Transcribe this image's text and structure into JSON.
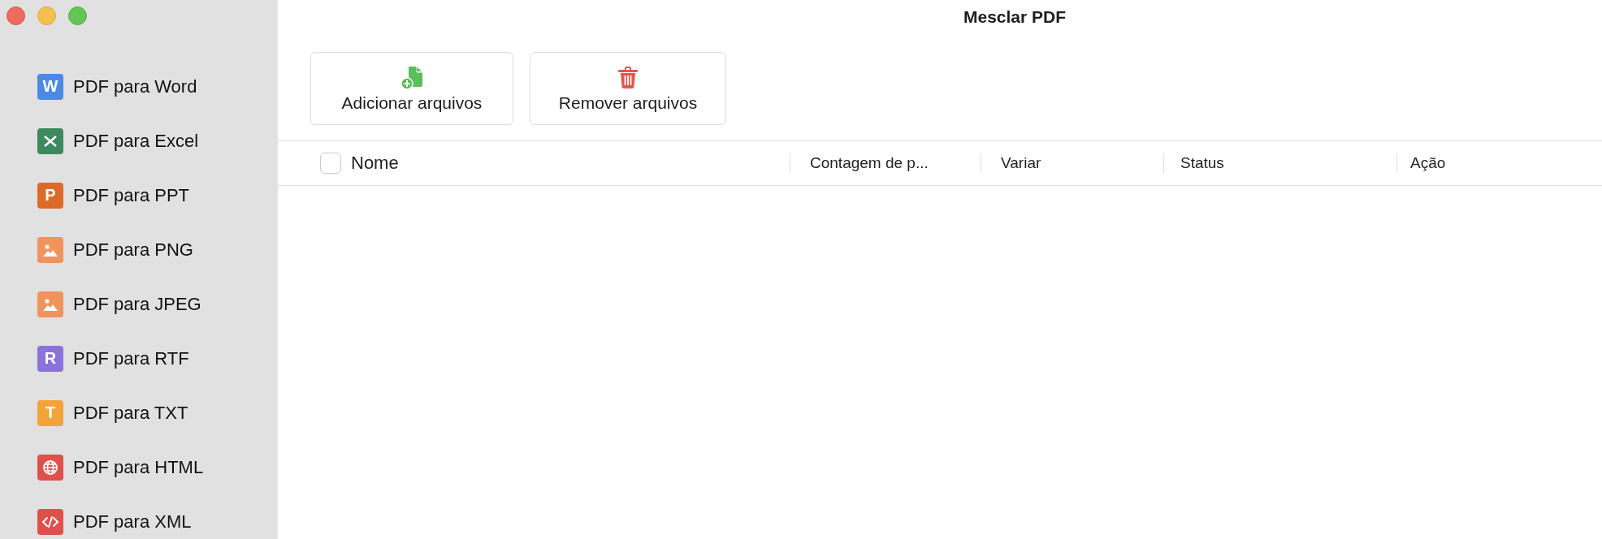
{
  "window": {
    "title": "Mesclar PDF"
  },
  "sidebar": {
    "items": [
      {
        "label": "PDF para Word",
        "kind": "word",
        "glyph": "W",
        "selected": false
      },
      {
        "label": "PDF para Excel",
        "kind": "excel",
        "selected": false
      },
      {
        "label": "PDF para PPT",
        "kind": "ppt",
        "glyph": "P",
        "selected": false
      },
      {
        "label": "PDF para PNG",
        "kind": "image",
        "selected": false
      },
      {
        "label": "PDF para JPEG",
        "kind": "image",
        "selected": false
      },
      {
        "label": "PDF para RTF",
        "kind": "rtf",
        "glyph": "R",
        "selected": false
      },
      {
        "label": "PDF para TXT",
        "kind": "txt",
        "glyph": "T",
        "selected": false
      },
      {
        "label": "PDF para HTML",
        "kind": "html",
        "selected": false
      },
      {
        "label": "PDF para XML",
        "kind": "xml",
        "selected": false
      }
    ]
  },
  "toolbar": [
    {
      "label": "Adicionar arquivos",
      "kind": "add"
    },
    {
      "label": "Remover arquivos",
      "kind": "remove"
    }
  ],
  "table": {
    "select_all": {
      "checked": false
    },
    "columns": [
      "Nome",
      "Contagem de p...",
      "Variar",
      "Status",
      "Ação"
    ]
  }
}
